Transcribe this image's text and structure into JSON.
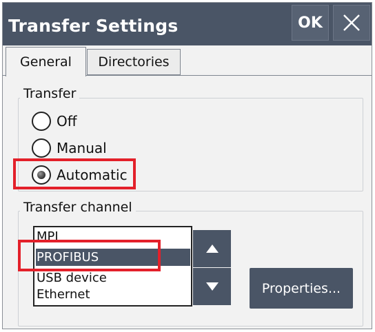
{
  "window": {
    "title": "Transfer Settings",
    "ok_label": "OK",
    "close_icon": "close-icon"
  },
  "tabs": [
    {
      "label": "General",
      "active": true
    },
    {
      "label": "Directories",
      "active": false
    }
  ],
  "transfer": {
    "group_label": "Transfer",
    "options": [
      {
        "label": "Off",
        "selected": false
      },
      {
        "label": "Manual",
        "selected": false
      },
      {
        "label": "Automatic",
        "selected": true
      }
    ]
  },
  "channel": {
    "group_label": "Transfer channel",
    "items": [
      "MPI",
      "PROFIBUS",
      "USB device",
      "Ethernet"
    ],
    "selected_item": "PROFIBUS",
    "scroll_up_icon": "triangle-up-icon",
    "scroll_down_icon": "triangle-down-icon",
    "properties_label": "Properties..."
  },
  "colors": {
    "accent": "#4a5566",
    "highlight": "#e3202a"
  }
}
